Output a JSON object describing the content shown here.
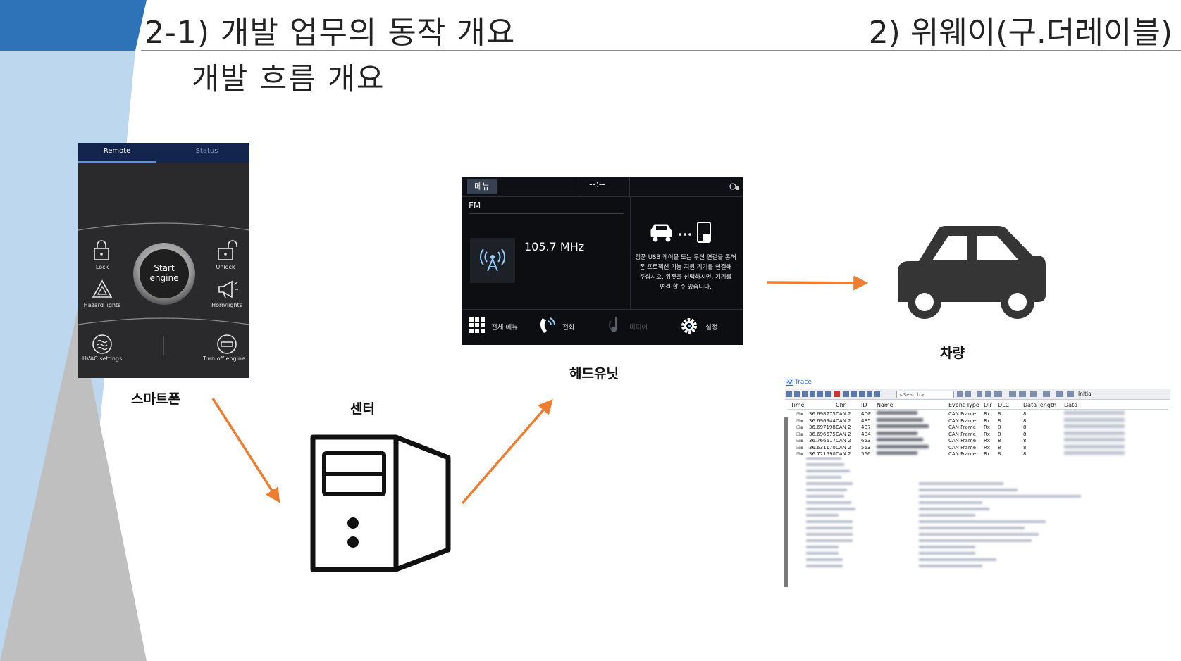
{
  "header": {
    "title": "2-1) 개발 업무의 동작 개요",
    "tag": "2) 위웨이(구.더레이블)",
    "subtitle": "개발 흐름 개요"
  },
  "colors": {
    "header_block": "#2e72b8",
    "sidebar_light_blue": "#bdd7ee",
    "sidebar_gray": "#bfbfbf",
    "arrow": "#ed7d31"
  },
  "captions": {
    "smartphone": "스마트폰",
    "center": "센터",
    "headunit": "헤드유닛",
    "vehicle": "차량"
  },
  "phone": {
    "tabs": [
      "Remote",
      "Status"
    ],
    "lock": "Lock",
    "unlock": "Unlock",
    "start_line1": "Start",
    "start_line2": "engine",
    "hazard": "Hazard lights",
    "horn": "Horn/lights",
    "hvac": "HVAC settings",
    "turn_off": "Turn off engine"
  },
  "headunit": {
    "menu": "메뉴",
    "clock": "--:--",
    "band": "FM",
    "frequency": "105.7 MHz",
    "message_lines": [
      "정품 USB 케이블 또는 무선 연결을 통해",
      "폰 프로젝션 기능 지원 기기를 연결해",
      "주십시오. 위젯을 선택하시면, 기기를",
      "연결 할 수 있습니다."
    ],
    "bottom": {
      "all_menu": "전체 메뉴",
      "phone": "전화",
      "media": "미디어",
      "settings": "설정"
    }
  },
  "trace": {
    "title": "Trace",
    "search_placeholder": "<Search>",
    "initial": "Initial",
    "columns": [
      "Time",
      "Chn",
      "ID",
      "Name",
      "Event Type",
      "Dir",
      "DLC",
      "Data length",
      "Data"
    ],
    "rows": [
      {
        "time": "36.698775",
        "chn": "CAN 2",
        "id": "4DF",
        "event": "CAN Frame",
        "dir": "Rx",
        "dlc": "8",
        "len": "8"
      },
      {
        "time": "36.696944",
        "chn": "CAN 2",
        "id": "4B5",
        "event": "CAN Frame",
        "dir": "Rx",
        "dlc": "8",
        "len": "8"
      },
      {
        "time": "36.697198",
        "chn": "CAN 2",
        "id": "4B7",
        "event": "CAN Frame",
        "dir": "Rx",
        "dlc": "8",
        "len": "8"
      },
      {
        "time": "36.696675",
        "chn": "CAN 2",
        "id": "4B4",
        "event": "CAN Frame",
        "dir": "Rx",
        "dlc": "8",
        "len": "8"
      },
      {
        "time": "36.766617",
        "chn": "CAN 2",
        "id": "653",
        "event": "CAN Frame",
        "dir": "Rx",
        "dlc": "8",
        "len": "8"
      },
      {
        "time": "36.631170",
        "chn": "CAN 2",
        "id": "563",
        "event": "CAN Frame",
        "dir": "Rx",
        "dlc": "8",
        "len": "8"
      },
      {
        "time": "36.721590",
        "chn": "CAN 2",
        "id": "566",
        "event": "CAN Frame",
        "dir": "Rx",
        "dlc": "8",
        "len": "8"
      }
    ]
  }
}
